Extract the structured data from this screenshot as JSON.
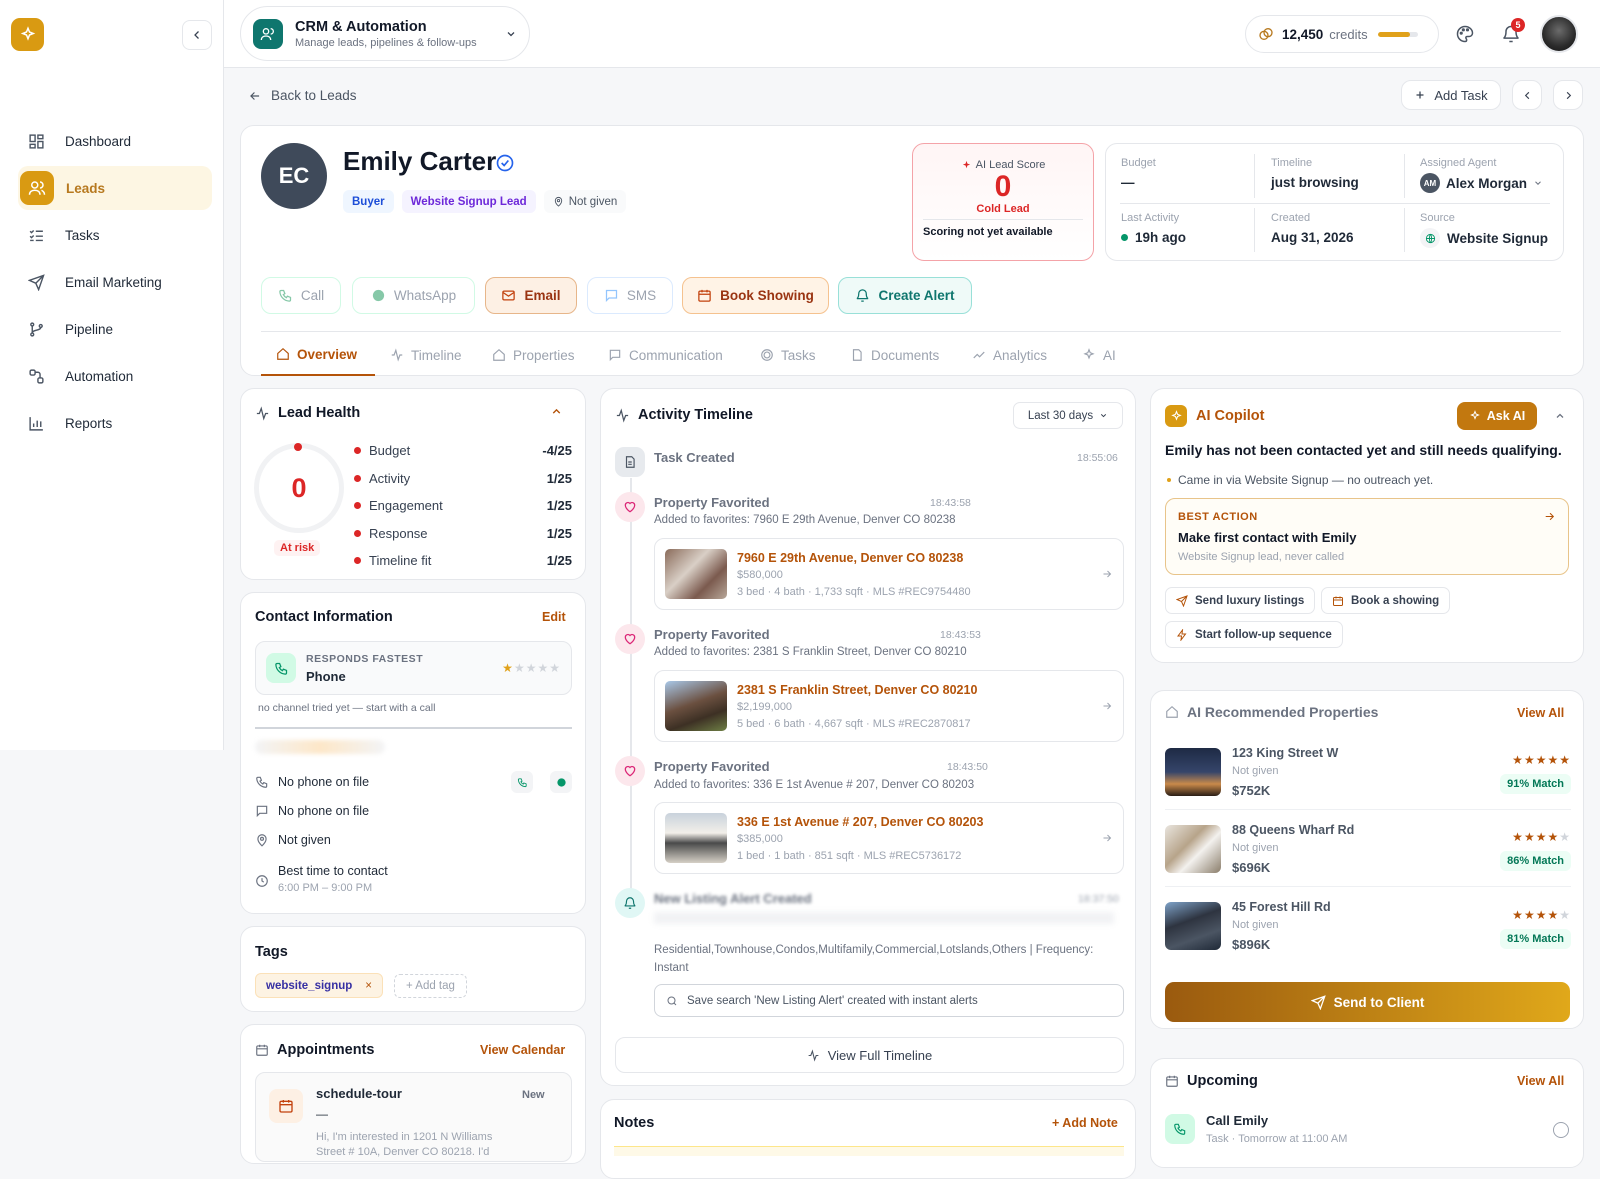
{
  "app": {
    "name": "CRM & Automation",
    "subtitle": "Manage leads, pipelines & follow-ups",
    "credits_value": "12,450",
    "credits_label": "credits",
    "credits_fill_fraction": 0.8,
    "notification_count": "5",
    "accent_color": "#d99a12"
  },
  "sidebar": {
    "items": [
      {
        "label": "Dashboard",
        "icon": "grid-icon"
      },
      {
        "label": "Leads",
        "icon": "users-icon",
        "active": true
      },
      {
        "label": "Tasks",
        "icon": "checklist-icon"
      },
      {
        "label": "Email Marketing",
        "icon": "send-icon"
      },
      {
        "label": "Pipeline",
        "icon": "branch-icon"
      },
      {
        "label": "Automation",
        "icon": "flow-icon"
      },
      {
        "label": "Reports",
        "icon": "bar-chart-icon"
      }
    ]
  },
  "header": {
    "back_label": "Back to Leads",
    "add_task_label": "Add Task"
  },
  "lead": {
    "initials": "EC",
    "name": "Emily Carter",
    "tags": [
      "Buyer",
      "Website Signup Lead"
    ],
    "location": "Not given",
    "score": {
      "label": "AI Lead Score",
      "value": "0",
      "status": "Cold Lead",
      "note": "Scoring not yet available"
    },
    "info": {
      "budget_label": "Budget",
      "budget_value": "—",
      "timeline_label": "Timeline",
      "timeline_value": "just browsing",
      "agent_label": "Assigned Agent",
      "agent_initials": "AM",
      "agent_value": "Alex Morgan",
      "activity_label": "Last Activity",
      "activity_value": "19h ago",
      "created_label": "Created",
      "created_value": "Aug 31, 2026",
      "source_label": "Source",
      "source_value": "Website Signup"
    }
  },
  "actions": {
    "call": "Call",
    "whatsapp": "WhatsApp",
    "email": "Email",
    "sms": "SMS",
    "book": "Book Showing",
    "alert": "Create Alert"
  },
  "tabs": [
    "Overview",
    "Timeline",
    "Properties",
    "Communication",
    "Tasks",
    "Documents",
    "Analytics",
    "AI"
  ],
  "health": {
    "title": "Lead Health",
    "score": "0",
    "status": "At risk",
    "rows": [
      {
        "label": "Budget",
        "value": "-4/25"
      },
      {
        "label": "Activity",
        "value": "1/25"
      },
      {
        "label": "Engagement",
        "value": "1/25"
      },
      {
        "label": "Response",
        "value": "1/25"
      },
      {
        "label": "Timeline fit",
        "value": "1/25"
      }
    ]
  },
  "contact": {
    "title": "Contact Information",
    "edit": "Edit",
    "fastest_label": "RESPONDS FASTEST",
    "fastest_value": "Phone",
    "fastest_rating": 1,
    "fastest_rating_max": 5,
    "note": "no channel tried yet — start with a call",
    "phone1": "No phone on file",
    "phone2": "No phone on file",
    "address": "Not given",
    "best_time_label": "Best time to contact",
    "best_time_value": "6:00 PM – 9:00 PM"
  },
  "tags_card": {
    "title": "Tags",
    "tag": "website_signup",
    "add_label": "+ Add tag"
  },
  "appointments": {
    "title": "Appointments",
    "view": "View Calendar",
    "item_title": "schedule-tour",
    "item_dash": "—",
    "item_status": "New",
    "item_text": "Hi, I'm interested in 1201 N Williams",
    "item_text2": "Street # 10A, Denver CO 80218. I'd"
  },
  "timeline": {
    "title": "Activity Timeline",
    "range": "Last 30 days",
    "events": [
      {
        "title": "Task Created",
        "time": "18:55:06"
      },
      {
        "title": "Property Favorited",
        "time": "18:43:58",
        "desc": "Added to favorites: 7960 E 29th Avenue, Denver CO 80238",
        "prop_title": "7960 E 29th Avenue, Denver CO 80238",
        "prop_price": "$580,000",
        "prop_meta": "3 bed · 4 bath · 1,733 sqft · MLS #REC9754480"
      },
      {
        "title": "Property Favorited",
        "time": "18:43:53",
        "desc": "Added to favorites: 2381 S Franklin Street, Denver CO 80210",
        "prop_title": "2381 S Franklin Street, Denver CO 80210",
        "prop_price": "$2,199,000",
        "prop_meta": "5 bed · 6 bath · 4,667 sqft · MLS #REC2870817"
      },
      {
        "title": "Property Favorited",
        "time": "18:43:50",
        "desc": "Added to favorites: 336 E 1st Avenue # 207, Denver CO 80203",
        "prop_title": "336 E 1st Avenue # 207, Denver CO 80203",
        "prop_price": "$385,000",
        "prop_meta": "1 bed · 1 bath · 851 sqft · MLS #REC5736172"
      },
      {
        "title": "New Listing Alert Created",
        "time": "18:37:50",
        "desc": "Residential,Townhouse,Condos,Multifamily,Commercial,Lotslands,Others | Frequency:",
        "desc2": "Instant",
        "search": "Save search 'New Listing Alert' created with instant alerts"
      }
    ],
    "view_full": "View Full Timeline"
  },
  "notes": {
    "title": "Notes",
    "add": "+ Add Note"
  },
  "copilot": {
    "title": "AI Copilot",
    "ask": "Ask AI",
    "headline": "Emily has not been contacted yet and still needs qualifying.",
    "bullet": "Came in via Website Signup — no outreach yet.",
    "best_label": "BEST ACTION",
    "best_title": "Make first contact with Emily",
    "best_sub": "Website Signup lead, never called",
    "chips": [
      "Send luxury listings",
      "Book a showing",
      "Start follow-up sequence"
    ]
  },
  "recommended": {
    "title": "AI Recommended Properties",
    "view": "View All",
    "items": [
      {
        "address": "123 King Street W",
        "location": "Not given",
        "price": "$752K",
        "stars": 5,
        "match": "91% Match"
      },
      {
        "address": "88 Queens Wharf Rd",
        "location": "Not given",
        "price": "$696K",
        "stars": 4,
        "match": "86% Match"
      },
      {
        "address": "45 Forest Hill Rd",
        "location": "Not given",
        "price": "$896K",
        "stars": 4,
        "match": "81% Match"
      }
    ],
    "send": "Send to Client"
  },
  "upcoming": {
    "title": "Upcoming",
    "view": "View All",
    "item_title": "Call Emily",
    "item_sub": "Task · Tomorrow at 11:00 AM"
  }
}
